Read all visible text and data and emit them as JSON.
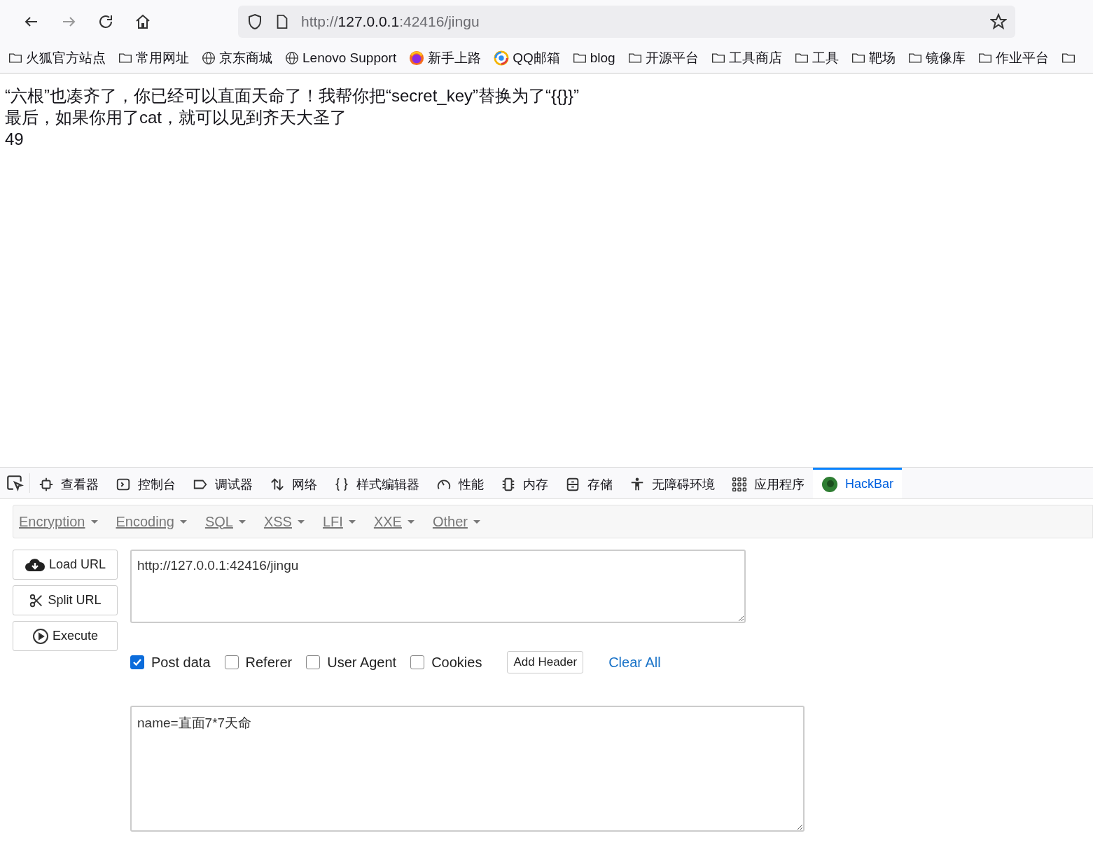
{
  "browser": {
    "url": {
      "scheme": "http://",
      "host": "127.0.0.1",
      "rest": ":42416/jingu"
    },
    "bookmarks": [
      {
        "kind": "folder",
        "label": "火狐官方站点"
      },
      {
        "kind": "folder",
        "label": "常用网址"
      },
      {
        "kind": "globe",
        "label": "京东商城"
      },
      {
        "kind": "globe",
        "label": "Lenovo Support"
      },
      {
        "kind": "firefox",
        "label": "新手上路"
      },
      {
        "kind": "qq",
        "label": "QQ邮箱"
      },
      {
        "kind": "folder",
        "label": "blog"
      },
      {
        "kind": "folder",
        "label": "开源平台"
      },
      {
        "kind": "folder",
        "label": "工具商店"
      },
      {
        "kind": "folder",
        "label": "工具"
      },
      {
        "kind": "folder",
        "label": "靶场"
      },
      {
        "kind": "folder",
        "label": "镜像库"
      },
      {
        "kind": "folder",
        "label": "作业平台"
      },
      {
        "kind": "folder"
      }
    ]
  },
  "page": {
    "lines": [
      "“六根”也凑齐了，你已经可以直面天命了！我帮你把“secret_key”替换为了“{{}}”",
      "最后，如果你用了cat，就可以见到齐天大圣了",
      "49"
    ]
  },
  "devtools": {
    "tabs": [
      {
        "kind": "inspector",
        "label": "查看器",
        "selected": false
      },
      {
        "kind": "console",
        "label": "控制台",
        "selected": false
      },
      {
        "kind": "debugger",
        "label": "调试器",
        "selected": false
      },
      {
        "kind": "network",
        "label": "网络",
        "selected": false
      },
      {
        "kind": "style",
        "label": "样式编辑器",
        "selected": false
      },
      {
        "kind": "performance",
        "label": "性能",
        "selected": false
      },
      {
        "kind": "memory",
        "label": "内存",
        "selected": false
      },
      {
        "kind": "storage",
        "label": "存储",
        "selected": false
      },
      {
        "kind": "accessibility",
        "label": "无障碍环境",
        "selected": false
      },
      {
        "kind": "apps",
        "label": "应用程序",
        "selected": false
      },
      {
        "kind": "hackbar",
        "label": "HackBar",
        "selected": true
      }
    ]
  },
  "hackbar": {
    "menus": [
      "Encryption",
      "Encoding",
      "SQL",
      "XSS",
      "LFI",
      "XXE",
      "Other"
    ],
    "actions": [
      {
        "kind": "load",
        "label": "Load URL"
      },
      {
        "kind": "split",
        "label": "Split URL"
      },
      {
        "kind": "execute",
        "label": "Execute"
      }
    ],
    "url_value": "http://127.0.0.1:42416/jingu",
    "options": [
      {
        "label": "Post data",
        "checked": true
      },
      {
        "label": "Referer",
        "checked": false
      },
      {
        "label": "User Agent",
        "checked": false
      },
      {
        "label": "Cookies",
        "checked": false
      }
    ],
    "add_header": "Add Header",
    "clear_all": "Clear All",
    "post_value": "name=直面7*7天命"
  }
}
